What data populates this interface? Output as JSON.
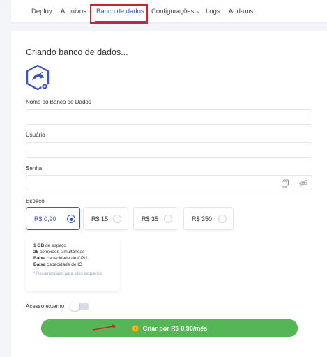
{
  "nav": {
    "items": [
      {
        "label": "Deploy",
        "dropdown": false
      },
      {
        "label": "Arquivos",
        "dropdown": true
      },
      {
        "label": "Banco de dados",
        "dropdown": false,
        "active": true
      },
      {
        "label": "Configurações",
        "dropdown": true
      },
      {
        "label": "Logs",
        "dropdown": false
      },
      {
        "label": "Add-ons",
        "dropdown": false
      }
    ]
  },
  "form": {
    "title": "Criando banco de dados...",
    "logo_icon": "mysql-dolphin-hexagon-icon",
    "db_name_label": "Nome do Banco de Dados",
    "user_label": "Usuário",
    "password_label": "Senha",
    "password_icons": [
      "copy-icon",
      "eye-off-icon"
    ],
    "space_label": "Espaço",
    "plans": [
      {
        "label": "R$ 0,90",
        "selected": true
      },
      {
        "label": "R$ 15",
        "selected": false
      },
      {
        "label": "R$ 35",
        "selected": false
      },
      {
        "label": "R$ 350",
        "selected": false
      }
    ],
    "specs": {
      "line1_bold": "1 GB",
      "line1_rest": " de espaço",
      "line2_bold": "25",
      "line2_rest": " conexões simultâneas",
      "line3_bold": "Baixa",
      "line3_rest": " capacidade de CPU",
      "line4_bold": "Baixa",
      "line4_rest": " capacidade de IO",
      "note": "* Recomendado para sites pequenos"
    },
    "external_access_label": "Acesso externo",
    "external_access_enabled": false,
    "create_button_label": "Criar por R$ 0,90/mês"
  },
  "colors": {
    "accent": "#3a55c8",
    "create_green": "#55b655",
    "annotation_red": "#e01b24"
  }
}
